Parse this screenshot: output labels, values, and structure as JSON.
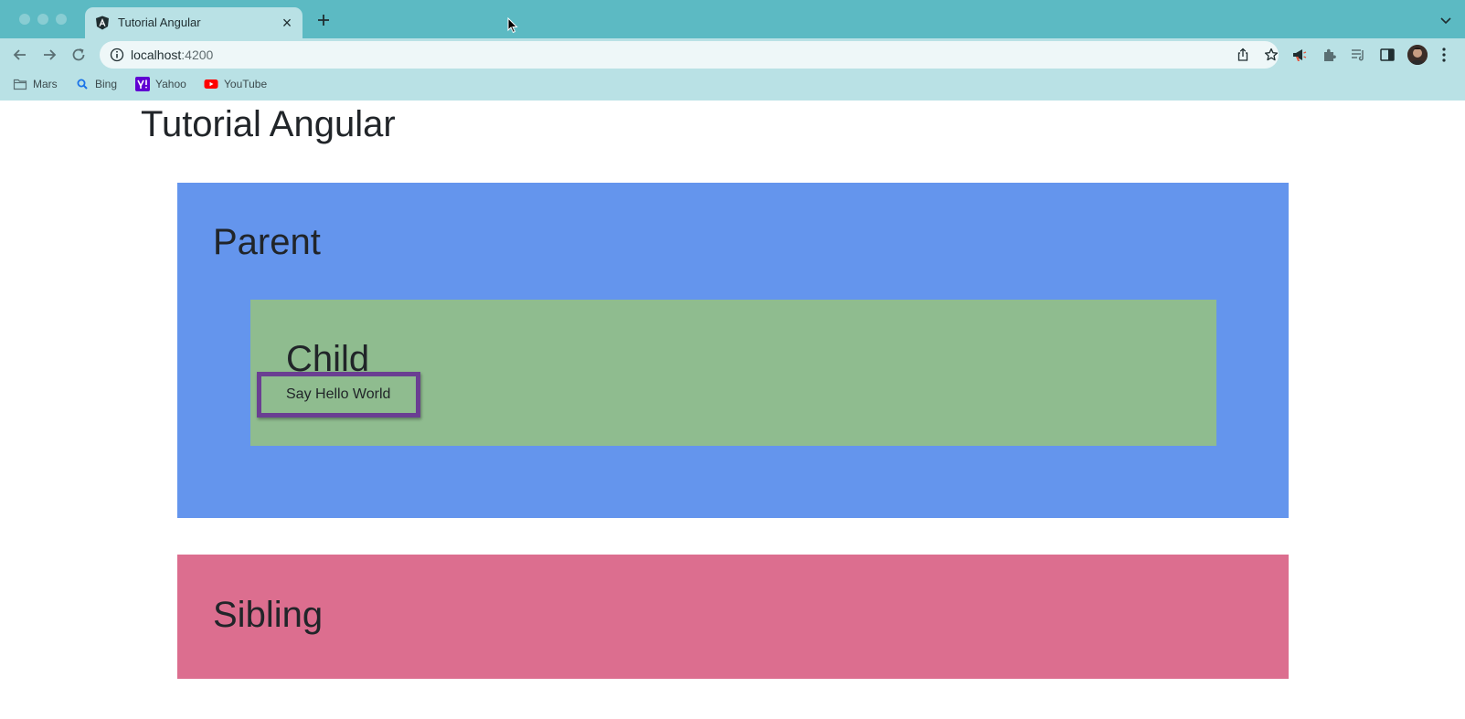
{
  "browser": {
    "tab": {
      "title": "Tutorial Angular",
      "favicon": "angular-logo-icon"
    },
    "omnibox": {
      "host": "localhost",
      "port": ":4200"
    },
    "bookmarks": [
      {
        "label": "Mars",
        "icon": "folder-icon"
      },
      {
        "label": "Bing",
        "icon": "bing-search-icon"
      },
      {
        "label": "Yahoo",
        "icon": "yahoo-icon"
      },
      {
        "label": "YouTube",
        "icon": "youtube-icon"
      }
    ],
    "colors": {
      "tabstrip": "#5cbac3",
      "toolbar": "#b9e1e5"
    }
  },
  "app": {
    "title": "Tutorial Angular",
    "parent": {
      "heading": "Parent",
      "color": "#6495ed"
    },
    "child": {
      "heading": "Child",
      "button_label": "Say Hello World",
      "color": "#8fbc8f",
      "button_border_color": "#6a3e92"
    },
    "sibling": {
      "heading": "Sibling",
      "color": "#dc6e8f"
    }
  }
}
